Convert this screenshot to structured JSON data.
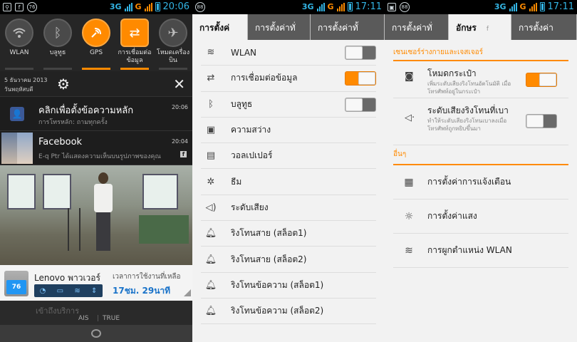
{
  "panel1": {
    "status": {
      "time": "20:06",
      "network": "3G",
      "g": "G",
      "badge": "76"
    },
    "quick_settings": [
      {
        "label": "WLAN",
        "icon": "wifi-icon",
        "on": false
      },
      {
        "label": "บลูทูธ",
        "icon": "bluetooth-icon",
        "on": false
      },
      {
        "label": "GPS",
        "icon": "gps-icon",
        "on": true
      },
      {
        "label": "การเชื่อมต่อข้อมูล",
        "icon": "data-connection-icon",
        "on": true
      },
      {
        "label": "โหมดเครื่องบิน",
        "icon": "airplane-icon",
        "on": false
      }
    ],
    "date_line1": "5 ธันวาคม 2013",
    "date_line2": "วันพฤหัสบดี",
    "notifications": [
      {
        "title": "คลิกเพื่อตั้งข้อความหลัก",
        "sub": "การโทรหลัก: ถามทุกครั้ง",
        "time": "20:06"
      },
      {
        "title": "Facebook",
        "sub": "E-q Ptr ได้แสดงความเห็นบนรูปภาพของคุณ",
        "time": "20:04"
      }
    ],
    "power": {
      "battery_level": "76",
      "name": "Lenovo พาวเวอร์",
      "remaining_label": "เวลาการใช้งานที่เหลือ",
      "remaining_value": "17ชม. 29นาที"
    },
    "carrier_faded": "เข้าถึงบริการ",
    "carrier1": "AIS",
    "carrier_sep": "|",
    "carrier2": "TRUE"
  },
  "panel2": {
    "status": {
      "time": "17:11",
      "network": "3G",
      "g": "G",
      "badge": "88"
    },
    "tabs": [
      "การตั้งค่",
      "การตั้งค่าทั่",
      "การตั้งค่าทั้"
    ],
    "items": [
      {
        "label": "WLAN",
        "icon": "wifi-icon",
        "toggle": "off"
      },
      {
        "label": "การเชื่อมต่อข้อมูล",
        "icon": "data-connection-icon",
        "toggle": "on"
      },
      {
        "label": "บลูทูธ",
        "icon": "bluetooth-icon",
        "toggle": "off"
      },
      {
        "label": "ความสว่าง",
        "icon": "brightness-icon",
        "toggle": ""
      },
      {
        "label": "วอลเปเปอร์",
        "icon": "wallpaper-icon",
        "toggle": ""
      },
      {
        "label": "ธีม",
        "icon": "theme-icon",
        "toggle": ""
      },
      {
        "label": "ระดับเสียง",
        "icon": "volume-icon",
        "toggle": ""
      },
      {
        "label": "ริงโทนสาย (สล็อต1)",
        "icon": "bell-icon",
        "toggle": ""
      },
      {
        "label": "ริงโทนสาย (สล็อต2)",
        "icon": "bell-icon",
        "toggle": ""
      },
      {
        "label": "ริงโทนข้อความ (สล็อต1)",
        "icon": "bell-icon",
        "toggle": ""
      },
      {
        "label": "ริงโทนข้อความ (สล็อต2)",
        "icon": "bell-icon",
        "toggle": ""
      }
    ]
  },
  "panel3": {
    "status": {
      "time": "17:11",
      "network": "3G",
      "g": "G",
      "badge": "88"
    },
    "tabs": [
      "การตั้งค่าทั่",
      "อักษร",
      "การตั้งค่า"
    ],
    "tab_extra": "f",
    "section1": "เซนเซอร์ร่างกายและเจสเจอร์",
    "sensor_items": [
      {
        "title": "โหมดกระเป๋า",
        "sub": "เพิ่มระดับเสียงริงโทนอัตโนมัติ เมื่อโทรศัพท์อยู่ในกระเป๋า",
        "toggle": "on",
        "icon": "pocket-icon"
      },
      {
        "title": "ระดับเสียงริงโทนที่เบา",
        "sub": "ทำให้ระดับเสียงริงโทนเบาลงเมื่อโทรศัพท์ถูกหยิบขึ้นมา",
        "toggle": "off",
        "icon": "quiet-ring-icon"
      }
    ],
    "section2": "อื่นๆ",
    "other_items": [
      {
        "label": "การตั้งค่าการแจ้งเตือน",
        "icon": "notification-icon"
      },
      {
        "label": "การตั้งค่าแสง",
        "icon": "light-icon"
      },
      {
        "label": "การผูกตำแหน่ง WLAN",
        "icon": "wlan-location-icon"
      }
    ]
  },
  "colors": {
    "accent": "#ff8a00",
    "status_blue": "#33b5e5"
  }
}
